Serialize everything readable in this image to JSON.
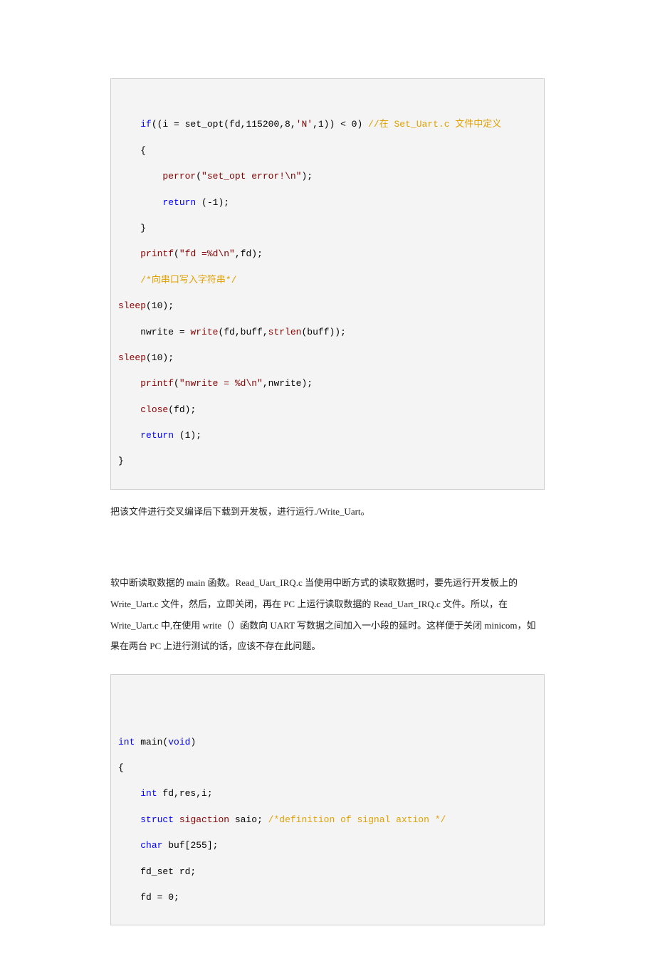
{
  "code1": {
    "l0": "    if((i = set_opt(fd,115200,8,'N',1)) < 0) //在 Set_Uart.c 文件中定义",
    "l1": "    {",
    "l2": "        perror(\"set_opt error!\\n\");",
    "l3": "        return (-1);",
    "l4": "    }",
    "l5": "    printf(\"fd =%d\\n\",fd);",
    "l6": "    /*向串口写入字符串*/",
    "l7": "sleep(10);",
    "l8": "    nwrite = write(fd,buff,strlen(buff));",
    "l9": "sleep(10);",
    "l10": "    printf(\"nwrite = %d\\n\",nwrite);",
    "l11": "    close(fd);",
    "l12": "    return (1);",
    "l13": "}"
  },
  "para1": "  把该文件进行交叉编译后下载到开发板，进行运行./Write_Uart。",
  "para2": "软中断读取数据的 main 函数。Read_Uart_IRQ.c 当使用中断方式的读取数据时，要先运行开发板上的Write_Uart.c 文件，然后，立即关闭，再在 PC 上运行读取数据的 Read_Uart_IRQ.c 文件。所以，在 Write_Uart.c 中,在使用 write（）函数向 UART 写数据之间加入一小段的延时。这样便于关闭 minicom，如果在两台 PC 上进行测试的话，应该不存在此问题。",
  "code2": {
    "l0": "int main(void)",
    "l1": "{",
    "l2": "    int fd,res,i;",
    "l3": "    struct sigaction saio; /*definition of signal axtion */",
    "l4": "    char buf[255];",
    "l5": "    fd_set rd;",
    "l6": "    fd = 0;"
  }
}
